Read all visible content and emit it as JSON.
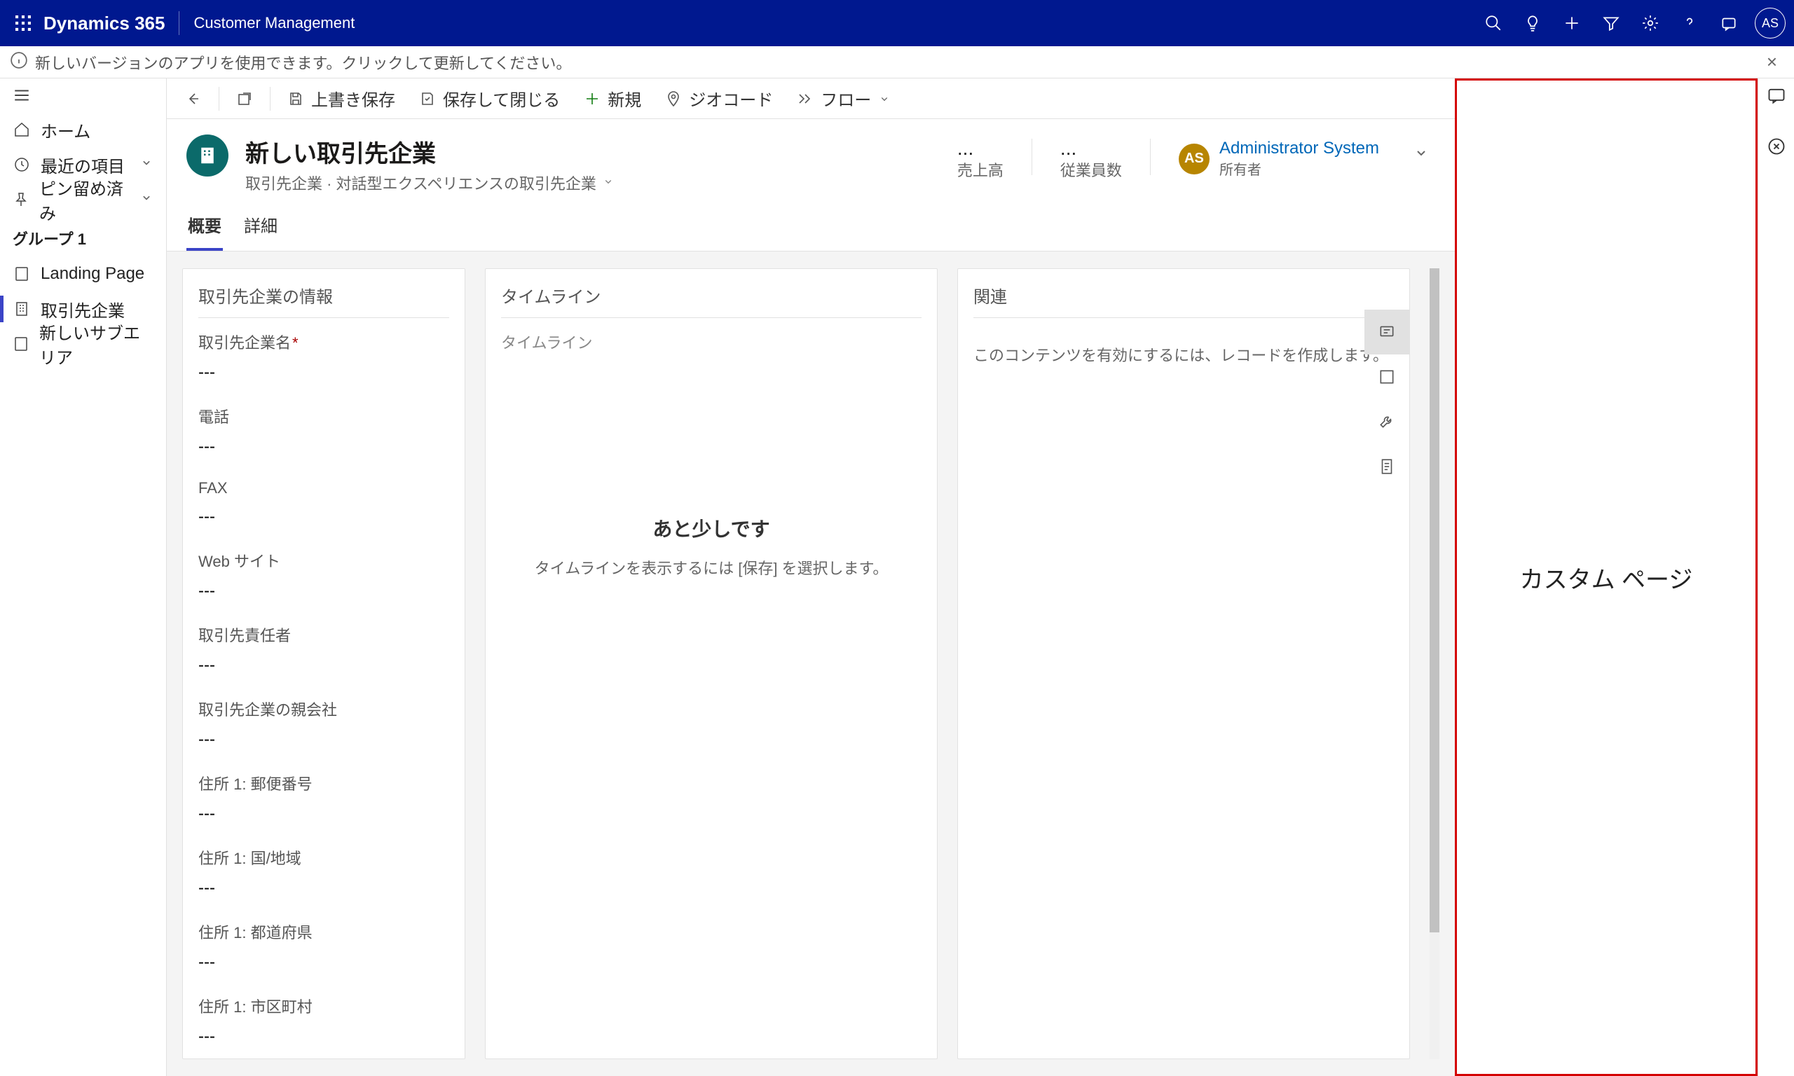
{
  "topbar": {
    "brand": "Dynamics 365",
    "app_name": "Customer Management",
    "avatar_initials": "AS"
  },
  "banner": {
    "message": "新しいバージョンのアプリを使用できます。クリックして更新してください。"
  },
  "leftnav": {
    "home": "ホーム",
    "recent": "最近の項目",
    "pinned": "ピン留め済み",
    "group_label": "グループ 1",
    "items": [
      {
        "label": "Landing Page"
      },
      {
        "label": "取引先企業"
      },
      {
        "label": "新しいサブエリア"
      }
    ]
  },
  "commands": {
    "save": "上書き保存",
    "save_close": "保存して閉じる",
    "new": "新規",
    "geocode": "ジオコード",
    "flow": "フロー"
  },
  "record": {
    "title": "新しい取引先企業",
    "subtitle": "取引先企業 · 対話型エクスペリエンスの取引先企業",
    "stat1_label": "売上高",
    "stat2_label": "従業員数",
    "owner_initials": "AS",
    "owner_name": "Administrator System",
    "owner_label": "所有者"
  },
  "tabs": {
    "summary": "概要",
    "details": "詳細"
  },
  "sections": {
    "account_info": "取引先企業の情報",
    "timeline": "タイムライン",
    "timeline_sub": "タイムライン",
    "related": "関連"
  },
  "fields": [
    {
      "label": "取引先企業名",
      "value": "---",
      "required": true
    },
    {
      "label": "電話",
      "value": "---"
    },
    {
      "label": "FAX",
      "value": "---"
    },
    {
      "label": "Web サイト",
      "value": "---"
    },
    {
      "label": "取引先責任者",
      "value": "---"
    },
    {
      "label": "取引先企業の親会社",
      "value": "---"
    },
    {
      "label": "住所 1: 郵便番号",
      "value": "---"
    },
    {
      "label": "住所 1: 国/地域",
      "value": "---"
    },
    {
      "label": "住所 1: 都道府県",
      "value": "---"
    },
    {
      "label": "住所 1: 市区町村",
      "value": "---"
    }
  ],
  "timeline_empty": {
    "title": "あと少しです",
    "message": "タイムラインを表示するには [保存] を選択します。"
  },
  "related_msg": "このコンテンツを有効にするには、レコードを作成します。",
  "sidepane": {
    "title": "カスタム ページ"
  }
}
